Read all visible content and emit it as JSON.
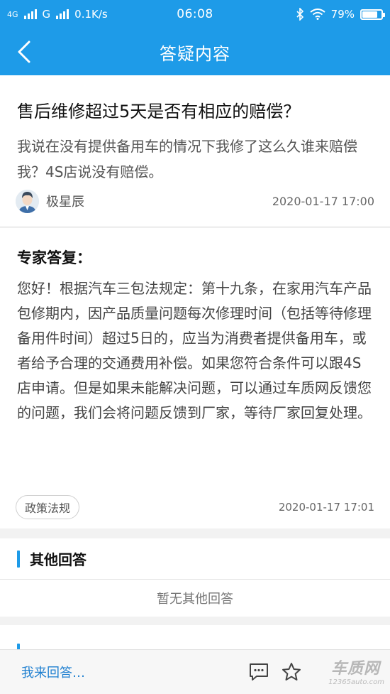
{
  "status_bar": {
    "net1": "4G",
    "net2": "G",
    "speed": "0.1K/s",
    "time": "06:08",
    "battery_text": "79%",
    "battery_level": 0.79
  },
  "nav": {
    "title": "答疑内容"
  },
  "question": {
    "title": "售后维修超过5天是否有相应的赔偿？",
    "description": "我说在没有提供备用车的情况下我修了这么久谁来赔偿我？4S店说没有赔偿。",
    "author": "极星辰",
    "date": "2020-01-17 17:00"
  },
  "answer": {
    "heading": "专家答复：",
    "body": "您好！根据汽车三包法规定：第十九条，在家用汽车产品包修期内，因产品质量问题每次修理时间（包括等待修理备用件时间）超过5日的，应当为消费者提供备用车，或者给予合理的交通费用补偿。如果您符合条件可以跟4S店申请。但是如果未能解决问题，可以通过车质网反馈您的问题，我们会将问题反馈到厂家，等待厂家回复处理。",
    "tag": "政策法规",
    "date": "2020-01-17 17:01"
  },
  "other_answers": {
    "title": "其他回答",
    "empty_text": "暂无其他回答"
  },
  "bottom": {
    "answer_button": "我来回答…",
    "watermark_main": "车质网",
    "watermark_sub": "12365auto.com"
  },
  "colors": {
    "brand": "#1e9be8",
    "link": "#1e7fd0"
  }
}
